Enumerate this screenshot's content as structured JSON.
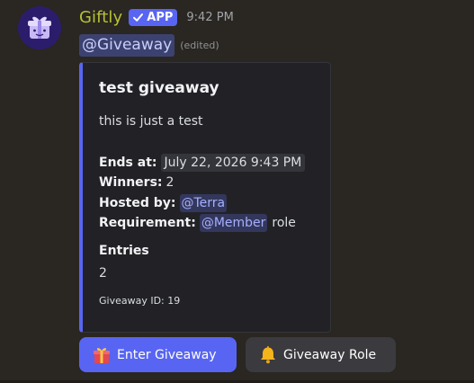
{
  "message": {
    "username": "Giftly",
    "badge_label": "APP",
    "timestamp": "9:42 PM",
    "mention": "@Giveaway",
    "edited_label": "(edited)"
  },
  "embed": {
    "accent_color": "#5865f2",
    "title": "test giveaway",
    "description": "this is just a test",
    "ends_label": "Ends at:",
    "ends_value": "July 22, 2026 9:43 PM",
    "winners_label": "Winners:",
    "winners_value": "2",
    "hosted_label": "Hosted by:",
    "hosted_value": "@Terra",
    "requirement_label": "Requirement:",
    "requirement_mention": "@Member",
    "requirement_suffix": "role",
    "field_name": "Entries",
    "field_value": "2",
    "footer": "Giveaway ID: 19"
  },
  "buttons": {
    "enter_label": "Enter Giveaway",
    "enter_icon": "gift-icon",
    "role_label": "Giveaway Role",
    "role_icon": "bell-icon"
  }
}
